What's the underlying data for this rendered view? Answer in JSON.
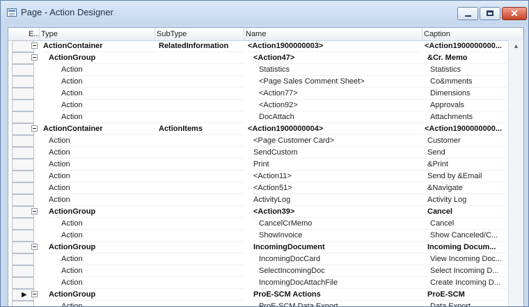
{
  "window": {
    "title": "Page - Action Designer",
    "buttons": {
      "minimize": "",
      "maximize": "",
      "close": "✕"
    }
  },
  "columns": [
    {
      "label": "E..."
    },
    {
      "label": "Type"
    },
    {
      "label": "SubType"
    },
    {
      "label": "Name"
    },
    {
      "label": "Caption"
    }
  ],
  "rows": [
    {
      "type": "ActionContainer",
      "subtype": "RelatedInformation",
      "name": "<Action1900000003>",
      "caption": "<Action1900000000...",
      "bold": true,
      "indent": 0,
      "expander": true
    },
    {
      "type": "ActionGroup",
      "subtype": "",
      "name": "<Action47>",
      "caption": "&Cr. Memo",
      "bold": true,
      "indent": 1,
      "expander": true
    },
    {
      "type": "Action",
      "subtype": "",
      "name": "Statistics",
      "caption": "Statistics",
      "bold": false,
      "indent": 2,
      "expander": false
    },
    {
      "type": "Action",
      "subtype": "",
      "name": "<Page Sales Comment Sheet>",
      "caption": "Co&mments",
      "bold": false,
      "indent": 2,
      "expander": false
    },
    {
      "type": "Action",
      "subtype": "",
      "name": "<Action77>",
      "caption": "Dimensions",
      "bold": false,
      "indent": 2,
      "expander": false
    },
    {
      "type": "Action",
      "subtype": "",
      "name": "<Action92>",
      "caption": "Approvals",
      "bold": false,
      "indent": 2,
      "expander": false
    },
    {
      "type": "Action",
      "subtype": "",
      "name": "DocAttach",
      "caption": "Attachments",
      "bold": false,
      "indent": 2,
      "expander": false
    },
    {
      "type": "ActionContainer",
      "subtype": "ActionItems",
      "name": "<Action1900000004>",
      "caption": "<Action1900000000...",
      "bold": true,
      "indent": 0,
      "expander": true
    },
    {
      "type": "Action",
      "subtype": "",
      "name": "<Page Customer Card>",
      "caption": "Customer",
      "bold": false,
      "indent": 1,
      "expander": false
    },
    {
      "type": "Action",
      "subtype": "",
      "name": "SendCustom",
      "caption": "Send",
      "bold": false,
      "indent": 1,
      "expander": false
    },
    {
      "type": "Action",
      "subtype": "",
      "name": "Print",
      "caption": "&Print",
      "bold": false,
      "indent": 1,
      "expander": false
    },
    {
      "type": "Action",
      "subtype": "",
      "name": "<Action11>",
      "caption": "Send by &Email",
      "bold": false,
      "indent": 1,
      "expander": false
    },
    {
      "type": "Action",
      "subtype": "",
      "name": "<Action51>",
      "caption": "&Navigate",
      "bold": false,
      "indent": 1,
      "expander": false
    },
    {
      "type": "Action",
      "subtype": "",
      "name": "ActivityLog",
      "caption": "Activity Log",
      "bold": false,
      "indent": 1,
      "expander": false
    },
    {
      "type": "ActionGroup",
      "subtype": "",
      "name": "<Action39>",
      "caption": "Cancel",
      "bold": true,
      "indent": 1,
      "expander": true
    },
    {
      "type": "Action",
      "subtype": "",
      "name": "CancelCrMemo",
      "caption": "Cancel",
      "bold": false,
      "indent": 2,
      "expander": false
    },
    {
      "type": "Action",
      "subtype": "",
      "name": "ShowInvoice",
      "caption": "Show Canceled/C...",
      "bold": false,
      "indent": 2,
      "expander": false
    },
    {
      "type": "ActionGroup",
      "subtype": "",
      "name": "IncomingDocument",
      "caption": "Incoming Docum...",
      "bold": true,
      "indent": 1,
      "expander": true
    },
    {
      "type": "Action",
      "subtype": "",
      "name": "IncomingDocCard",
      "caption": "View Incoming Doc...",
      "bold": false,
      "indent": 2,
      "expander": false
    },
    {
      "type": "Action",
      "subtype": "",
      "name": "SelectIncomingDoc",
      "caption": "Select Incoming D...",
      "bold": false,
      "indent": 2,
      "expander": false
    },
    {
      "type": "Action",
      "subtype": "",
      "name": "IncomingDocAttachFile",
      "caption": "Create Incoming D...",
      "bold": false,
      "indent": 2,
      "expander": false
    },
    {
      "type": "ActionGroup",
      "subtype": "",
      "name": "ProE-SCM Actions",
      "caption": "ProE-SCM",
      "bold": true,
      "indent": 1,
      "expander": true,
      "current": true
    },
    {
      "type": "Action",
      "subtype": "",
      "name": "ProE-SCM Data Export",
      "caption": "Data Export",
      "bold": false,
      "indent": 2,
      "expander": false
    }
  ]
}
